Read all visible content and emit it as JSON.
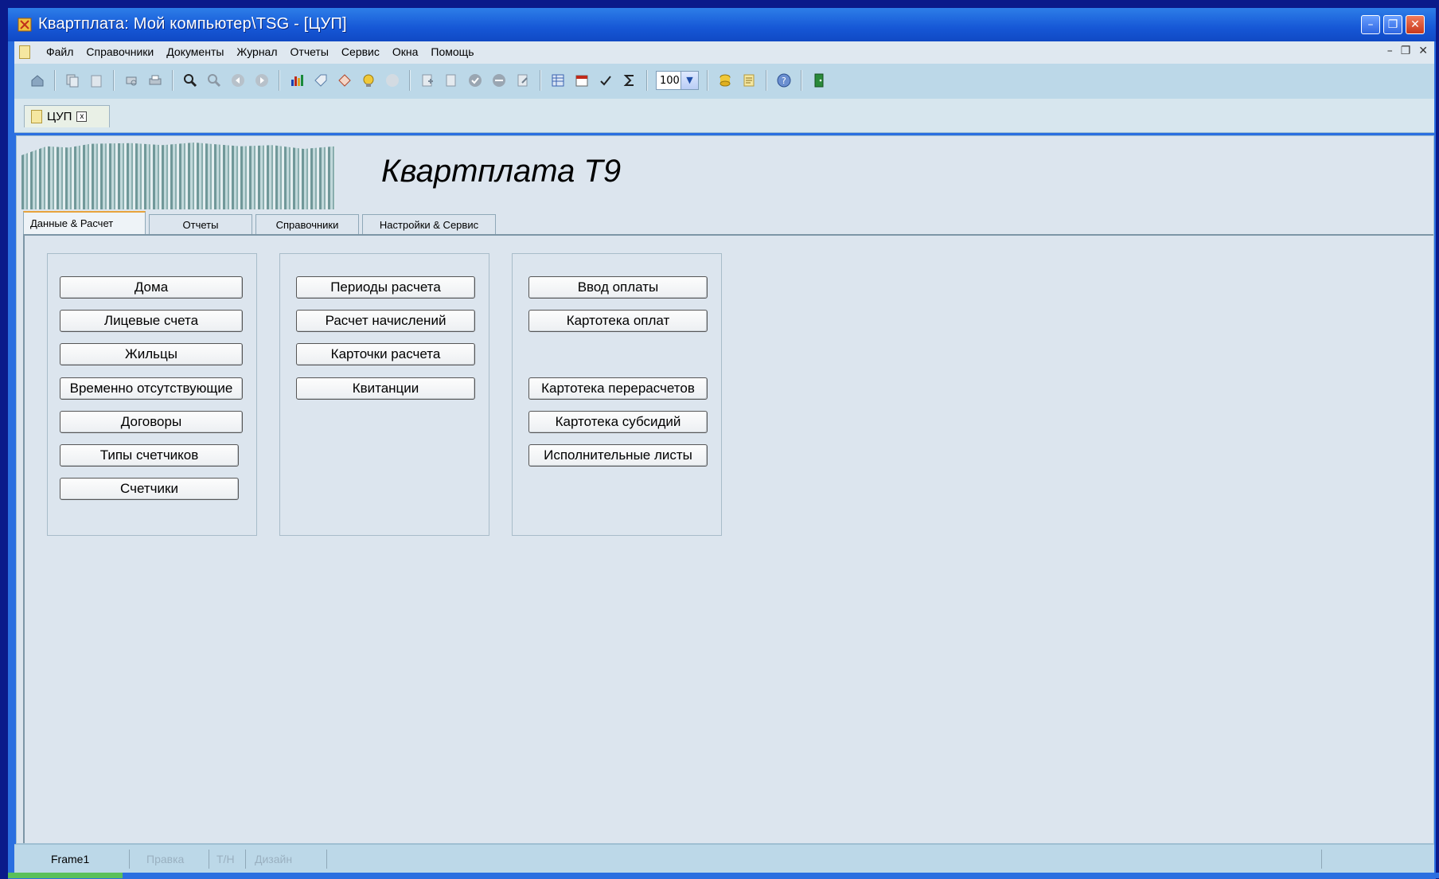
{
  "window": {
    "title": "Квартплата: Мой компьютер\\TSG - [ЦУП]",
    "minimize_glyph": "–",
    "restore_glyph": "❐",
    "close_glyph": "✕"
  },
  "menu": {
    "items": [
      "Файл",
      "Справочники",
      "Документы",
      "Журнал",
      "Отчеты",
      "Сервис",
      "Окна",
      "Помощь"
    ],
    "mdi_controls": [
      "–",
      "❐",
      "✕"
    ]
  },
  "toolbar": {
    "icons": [
      "home-icon",
      "copy-icon",
      "paste-icon",
      "print-preview-icon",
      "print-icon",
      "find-icon",
      "find-next-icon",
      "back-icon",
      "forward-icon",
      "chart-icon",
      "tag-icon",
      "tags-icon",
      "bulb-icon",
      "stop-icon",
      "new-doc-icon",
      "copy-doc-icon",
      "check-icon",
      "minus-icon",
      "export-icon",
      "table-icon",
      "calendar-icon",
      "spellcheck-icon",
      "sum-icon",
      "zoom-select",
      "db-icon",
      "notes-icon",
      "help-icon",
      "exit-icon"
    ],
    "zoom_value": "100"
  },
  "doc_tab": {
    "label": "ЦУП",
    "close_glyph": "x"
  },
  "header": {
    "app_title": "Квартплата Т9"
  },
  "tabs": [
    "Данные & Расчет",
    "Отчеты",
    "Справочники",
    "Настройки & Сервис"
  ],
  "groups": {
    "data": [
      "Дома",
      "Лицевые счета",
      "Жильцы",
      "Временно отсутствующие",
      "Договоры",
      "Типы счетчиков",
      "Счетчики"
    ],
    "calc": [
      "Периоды расчета",
      "Расчет начислений",
      "Карточки расчета",
      "Квитанции"
    ],
    "payments": [
      "Ввод оплаты",
      "Картотека оплат",
      "Картотека перерасчетов",
      "Картотека субсидий",
      "Исполнительные листы"
    ]
  },
  "status": {
    "items": [
      "Frame1",
      "Правка",
      "Т/Н",
      "Дизайн"
    ]
  },
  "colors": {
    "titlebar": "#1657d6",
    "toolbar": "#bcd8e8",
    "panel": "#dce5ee",
    "active_tab_accent": "#e8a33c"
  }
}
